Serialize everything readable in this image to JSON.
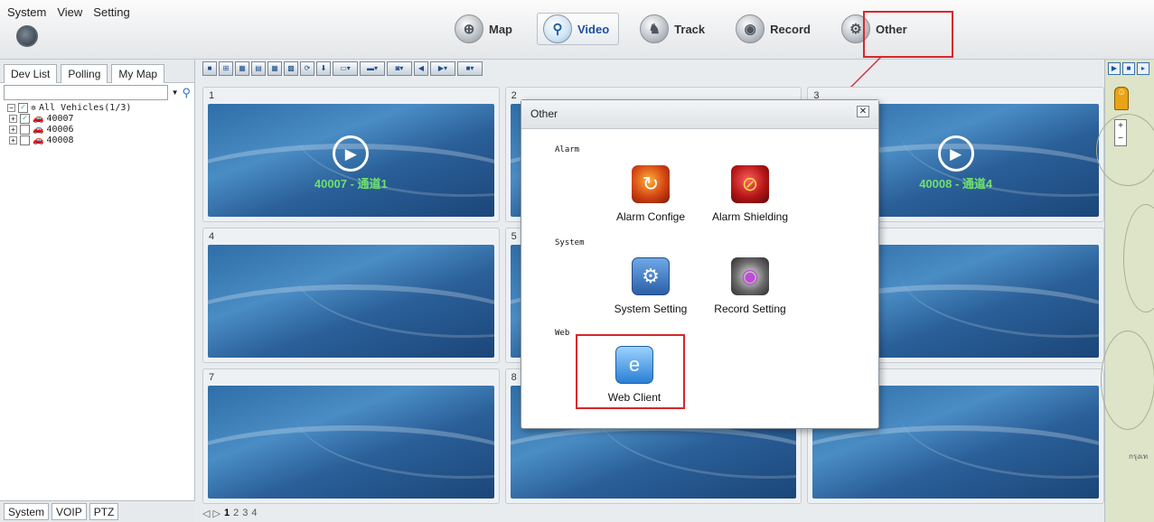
{
  "menu": {
    "system": "System",
    "view": "View",
    "setting": "Setting"
  },
  "nav": [
    {
      "label": "Map",
      "icon": "map-icon"
    },
    {
      "label": "Video",
      "icon": "video-icon",
      "active": true
    },
    {
      "label": "Track",
      "icon": "track-icon"
    },
    {
      "label": "Record",
      "icon": "record-icon"
    },
    {
      "label": "Other",
      "icon": "other-icon"
    }
  ],
  "left": {
    "tabs": [
      "Dev List",
      "Polling",
      "My Map"
    ],
    "search_value": "",
    "tree_root": "All Vehicles(1/3)",
    "vehicles": [
      {
        "id": "40007",
        "checked": true,
        "icon": "car-red-icon"
      },
      {
        "id": "40006",
        "checked": false,
        "icon": "car-gray-icon"
      },
      {
        "id": "40008",
        "checked": false,
        "icon": "car-gray-icon"
      }
    ],
    "bottom_tabs": [
      "System",
      "VOIP",
      "PTZ"
    ]
  },
  "grid": {
    "cells": [
      {
        "num": "1",
        "caption": "40007 - 通道1",
        "playing": true
      },
      {
        "num": "2",
        "caption": ""
      },
      {
        "num": "3",
        "caption": "40008 - 通道4",
        "playing": true
      },
      {
        "num": "4",
        "caption": ""
      },
      {
        "num": "5",
        "caption": ""
      },
      {
        "num": "6",
        "caption": ""
      },
      {
        "num": "7",
        "caption": ""
      },
      {
        "num": "8",
        "caption": ""
      },
      {
        "num": "9",
        "caption": ""
      }
    ]
  },
  "pages": {
    "nav": "◁ ▷",
    "items": [
      "1",
      "2",
      "3",
      "4"
    ],
    "current": "1"
  },
  "right": {
    "map_label": "กรุงเท"
  },
  "dialog": {
    "title": "Other",
    "close": "✕",
    "sections": {
      "alarm": "Alarm",
      "system": "System",
      "web": "Web"
    },
    "items": {
      "alarm_config": "Alarm Confige",
      "alarm_shielding": "Alarm Shielding",
      "system_setting": "System Setting",
      "record_setting": "Record Setting",
      "web_client": "Web Client"
    }
  },
  "colors": {
    "highlight": "#d9262b",
    "caption": "#6fe06f",
    "active_nav": "#1f4fa0"
  }
}
